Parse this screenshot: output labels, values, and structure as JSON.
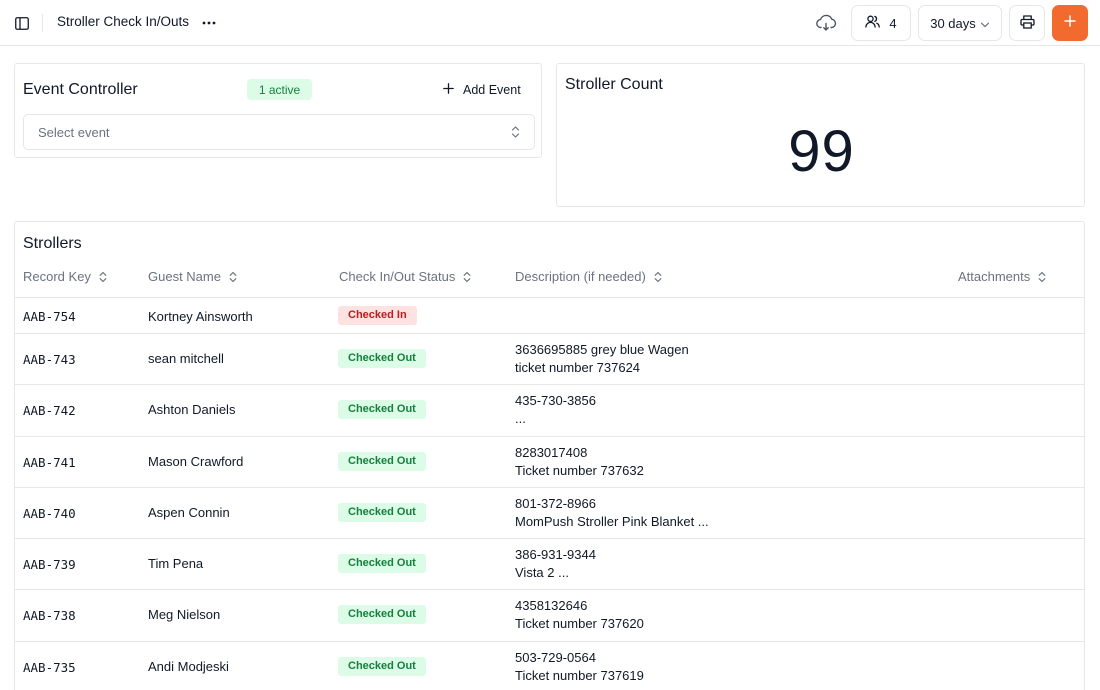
{
  "topbar": {
    "title": "Stroller Check In/Outs",
    "users_count": "4",
    "range_label": "30 days",
    "icons": {
      "sidebar": "sidebar-toggle-icon",
      "more": "more-horizontal-icon",
      "cloud": "cloud-sync-icon",
      "users": "users-icon",
      "chevron": "chevron-down-icon",
      "print": "printer-icon",
      "add": "plus-icon"
    },
    "accent_color": "#f26a2e"
  },
  "event_controller": {
    "title": "Event Controller",
    "active_badge": "1 active",
    "add_label": "Add Event",
    "select_placeholder": "Select event"
  },
  "stroller_count": {
    "title": "Stroller Count",
    "value": "99"
  },
  "strollers": {
    "title": "Strollers",
    "columns": [
      "Record Key",
      "Guest Name",
      "Check In/Out Status",
      "Description (if needed)",
      "Attachments"
    ],
    "status_colors": {
      "Checked In": "#b91c1c",
      "Checked Out": "#15803d"
    },
    "rows": [
      {
        "key": "AAB-754",
        "name": "Kortney Ainsworth",
        "status": "Checked In",
        "desc1": "",
        "desc2": ""
      },
      {
        "key": "AAB-743",
        "name": "sean mitchell",
        "status": "Checked Out",
        "desc1": "3636695885 grey blue Wagen",
        "desc2": "ticket number 737624"
      },
      {
        "key": "AAB-742",
        "name": "Ashton Daniels",
        "status": "Checked Out",
        "desc1": "435-730-3856",
        "desc2": "..."
      },
      {
        "key": "AAB-741",
        "name": "Mason Crawford",
        "status": "Checked Out",
        "desc1": "8283017408",
        "desc2": "Ticket number 737632"
      },
      {
        "key": "AAB-740",
        "name": "Aspen Connin",
        "status": "Checked Out",
        "desc1": "801-372-8966",
        "desc2": "MomPush Stroller Pink Blanket ..."
      },
      {
        "key": "AAB-739",
        "name": "Tim Pena",
        "status": "Checked Out",
        "desc1": "386-931-9344",
        "desc2": "Vista 2 ..."
      },
      {
        "key": "AAB-738",
        "name": "Meg Nielson",
        "status": "Checked Out",
        "desc1": "4358132646",
        "desc2": "Ticket number 737620"
      },
      {
        "key": "AAB-735",
        "name": "Andi Modjeski",
        "status": "Checked Out",
        "desc1": "503-729-0564",
        "desc2": "Ticket number 737619"
      }
    ]
  }
}
